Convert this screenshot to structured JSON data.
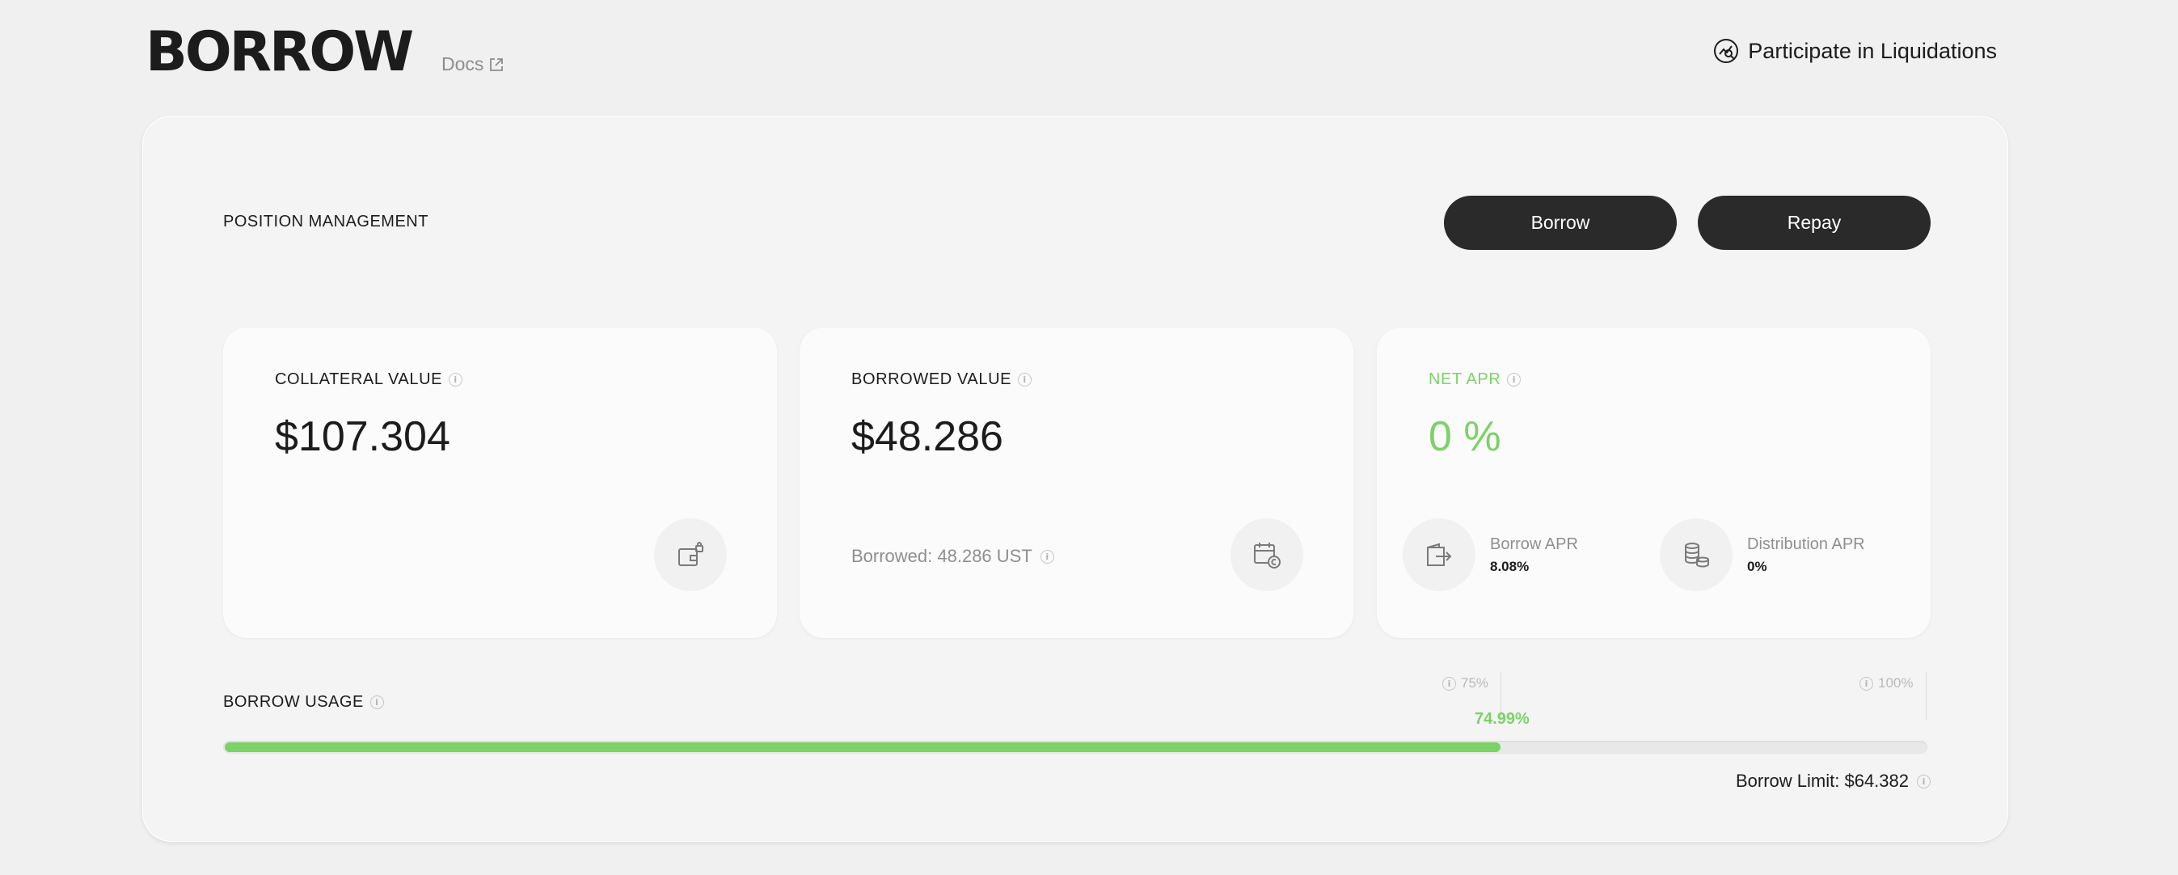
{
  "header": {
    "title": "BORROW",
    "docs_label": "Docs",
    "liquidations_label": "Participate in Liquidations"
  },
  "position": {
    "label": "POSITION MANAGEMENT",
    "borrow_button": "Borrow",
    "repay_button": "Repay"
  },
  "cards": {
    "collateral": {
      "title": "COLLATERAL VALUE",
      "value": "$107.304"
    },
    "borrowed": {
      "title": "BORROWED VALUE",
      "value": "$48.286",
      "detail": "Borrowed: 48.286 UST"
    },
    "net_apr": {
      "title": "NET APR",
      "value": "0 %",
      "borrow_apr_label": "Borrow APR",
      "borrow_apr_value": "8.08%",
      "distribution_apr_label": "Distribution APR",
      "distribution_apr_value": "0%"
    }
  },
  "usage": {
    "label": "BORROW USAGE",
    "marker_75": "75%",
    "marker_100": "100%",
    "percent_label": "74.99%",
    "percent": 74.99,
    "limit": "Borrow Limit: $64.382"
  },
  "colors": {
    "accent_green": "#7bd266",
    "button_dark": "#2a2a2a"
  },
  "icons": [
    "external-link-icon",
    "liquidation-chart-icon",
    "info-icon",
    "wallet-lock-icon",
    "calendar-coin-icon",
    "wallet-arrow-icon",
    "coins-stack-icon"
  ]
}
